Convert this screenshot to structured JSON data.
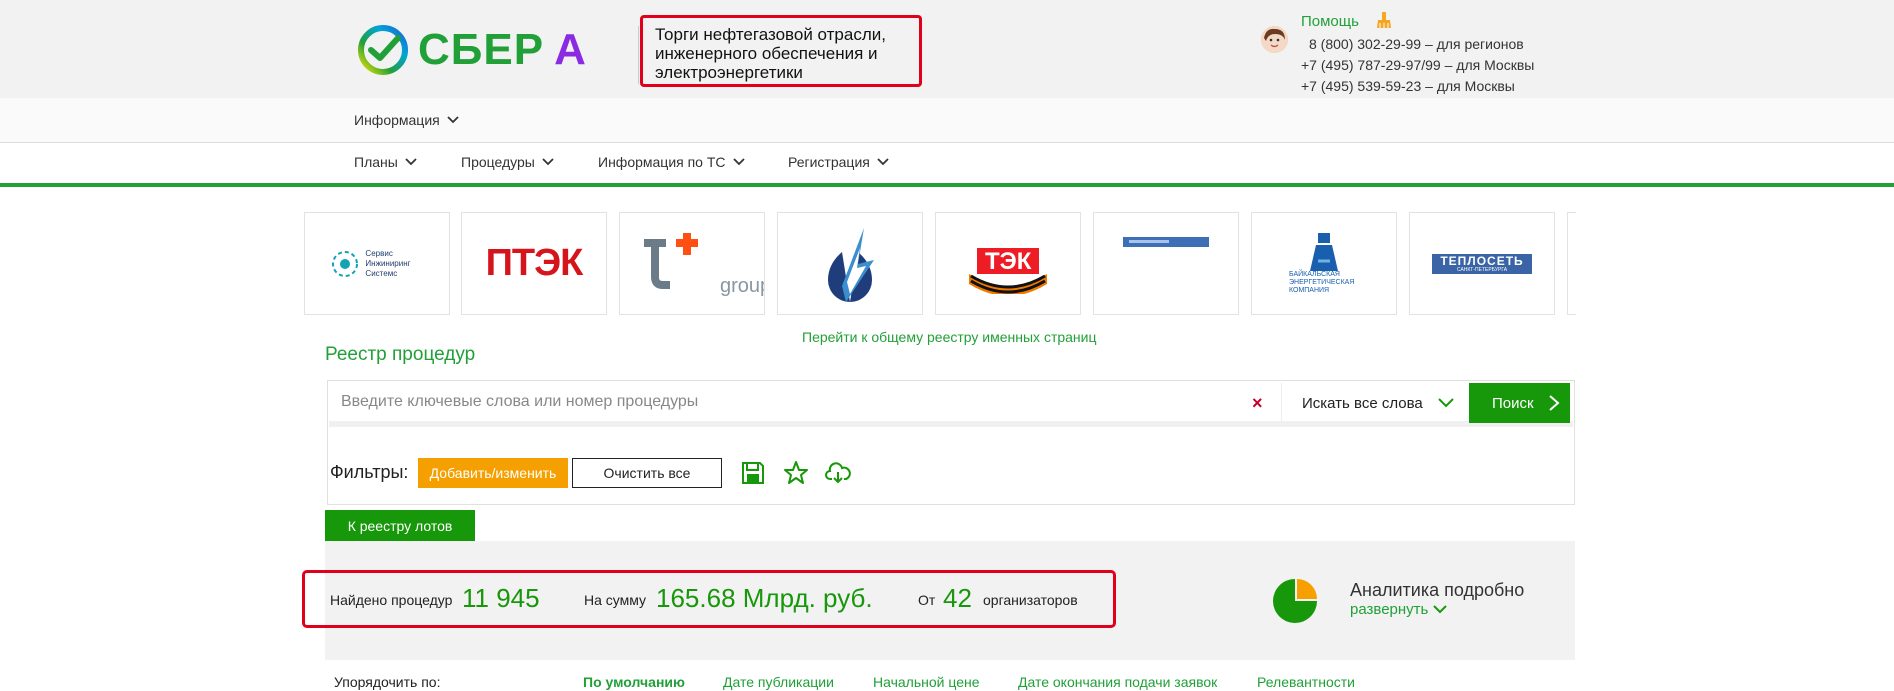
{
  "header": {
    "logo_text": "СБЕР",
    "logo_letter": "А",
    "subtitle": "Торги нефтегазовой отрасли, инженерного обеспечения и электроэнергетики",
    "help_label": "Помощь",
    "phones": [
      "8 (800) 302-29-99 – для регионов",
      "+7 (495) 787-29-97/99 – для Москвы",
      "+7 (495) 539-59-23 – для Москвы"
    ]
  },
  "info_menu": {
    "label": "Информация"
  },
  "main_menu": {
    "items": [
      {
        "label": "Планы"
      },
      {
        "label": "Процедуры"
      },
      {
        "label": "Информация по ТС"
      },
      {
        "label": "Регистрация"
      }
    ]
  },
  "carousel": {
    "cards": [
      {
        "name": "service-engineering",
        "lines": [
          "Сервис",
          "Инжиниринг",
          "Системс"
        ]
      },
      {
        "name": "ptek",
        "text": "ПТЭК"
      },
      {
        "name": "t-plus-group",
        "text": "group"
      },
      {
        "name": "energy-logo"
      },
      {
        "name": "tek-logo",
        "text": "ТЭК"
      },
      {
        "name": "blue-banner"
      },
      {
        "name": "baikal-energy",
        "lines": [
          "БАЙКАЛЬСКАЯ",
          "ЭНЕРГЕТИЧЕСКАЯ",
          "КОМПАНИЯ"
        ]
      },
      {
        "name": "teploset",
        "text": "ТЕПЛОСЕТЬ",
        "subtext": "САНКТ-ПЕТЕРБУРГА"
      }
    ],
    "all_pages_link": "Перейти к общему реестру именных страниц"
  },
  "registry": {
    "title": "Реестр процедур",
    "search_placeholder": "Введите ключевые слова или номер процедуры",
    "search_value": "",
    "clear_icon": "×",
    "search_mode": "Искать все слова",
    "search_button": "Поиск",
    "filters_label": "Фильтры:",
    "add_filter_button": "Добавить/изменить",
    "clear_all_button": "Очистить все",
    "lots_button": "К реестру лотов"
  },
  "stats": {
    "found_label": "Найдено процедур",
    "found_value": "11 945",
    "sum_label": "На сумму",
    "sum_value": "165.68 Млрд. руб.",
    "from_label": "От",
    "organizers_value": "42",
    "organizers_label": "организаторов",
    "analytics_title": "Аналитика подробно",
    "analytics_toggle": "развернуть"
  },
  "sort": {
    "label": "Упорядочить по:",
    "options": [
      {
        "label": "По умолчанию",
        "active": true
      },
      {
        "label": "Дате публикации"
      },
      {
        "label": "Начальной цене"
      },
      {
        "label": "Дате окончания подачи заявок"
      },
      {
        "label": "Релевантности"
      }
    ]
  },
  "colors": {
    "brand_green": "#21a038",
    "button_green": "#17970a",
    "accent_orange": "#f5a000",
    "highlight_red": "#e0001b"
  }
}
